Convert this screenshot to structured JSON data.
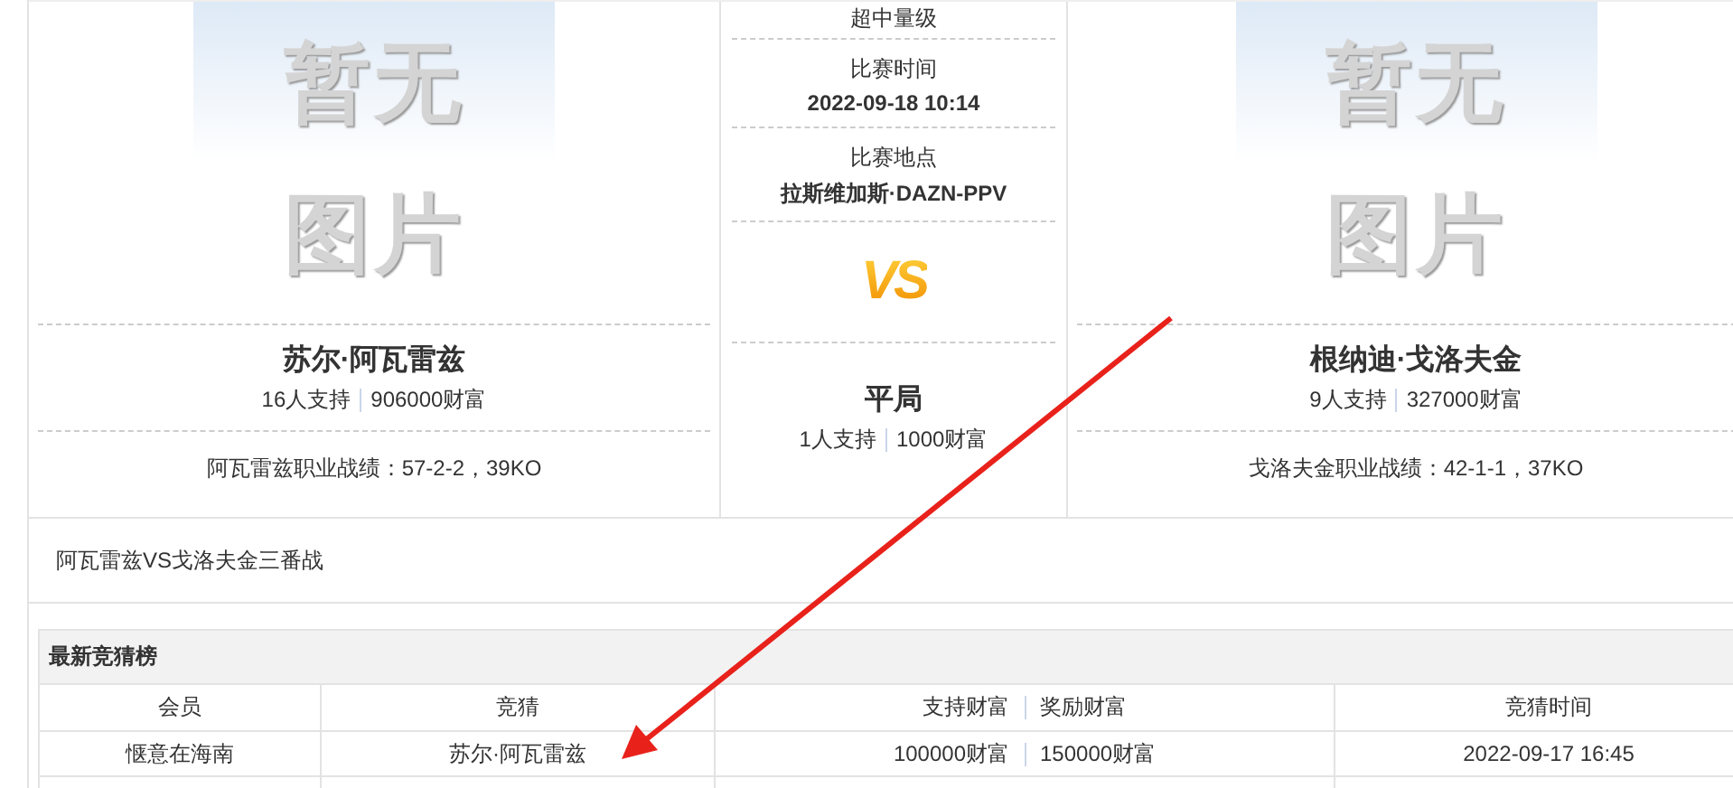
{
  "fighters": [
    {
      "image_text": [
        "暂无",
        "图片"
      ],
      "name": "苏尔·阿瓦雷兹",
      "supporters": "16人支持",
      "wealth": "906000财富",
      "record": "阿瓦雷兹职业战绩：57-2-2，39KO"
    },
    {
      "image_text": [
        "暂无",
        "图片"
      ],
      "name": "根纳迪·戈洛夫金",
      "supporters": "9人支持",
      "wealth": "327000财富",
      "record": "戈洛夫金职业战绩：42-1-1，37KO"
    }
  ],
  "match": {
    "weight_class": "超中量级",
    "time_label": "比赛时间",
    "time": "2022-09-18 10:14",
    "venue_label": "比赛地点",
    "venue": "拉斯维加斯·DAZN-PPV",
    "vs": "VS",
    "draw": {
      "name": "平局",
      "supporters": "1人支持",
      "wealth": "1000财富"
    }
  },
  "description": "阿瓦雷兹VS戈洛夫金三番战",
  "leaderboard": {
    "title": "最新竞猜榜",
    "columns": [
      "会员",
      "竞猜",
      "支持财富",
      "奖励财富",
      "竞猜时间"
    ],
    "rows": [
      {
        "member": "惬意在海南",
        "pick": "苏尔·阿瓦雷兹",
        "stake": "100000财富",
        "reward": "150000财富",
        "time": "2022-09-17 16:45"
      }
    ]
  }
}
